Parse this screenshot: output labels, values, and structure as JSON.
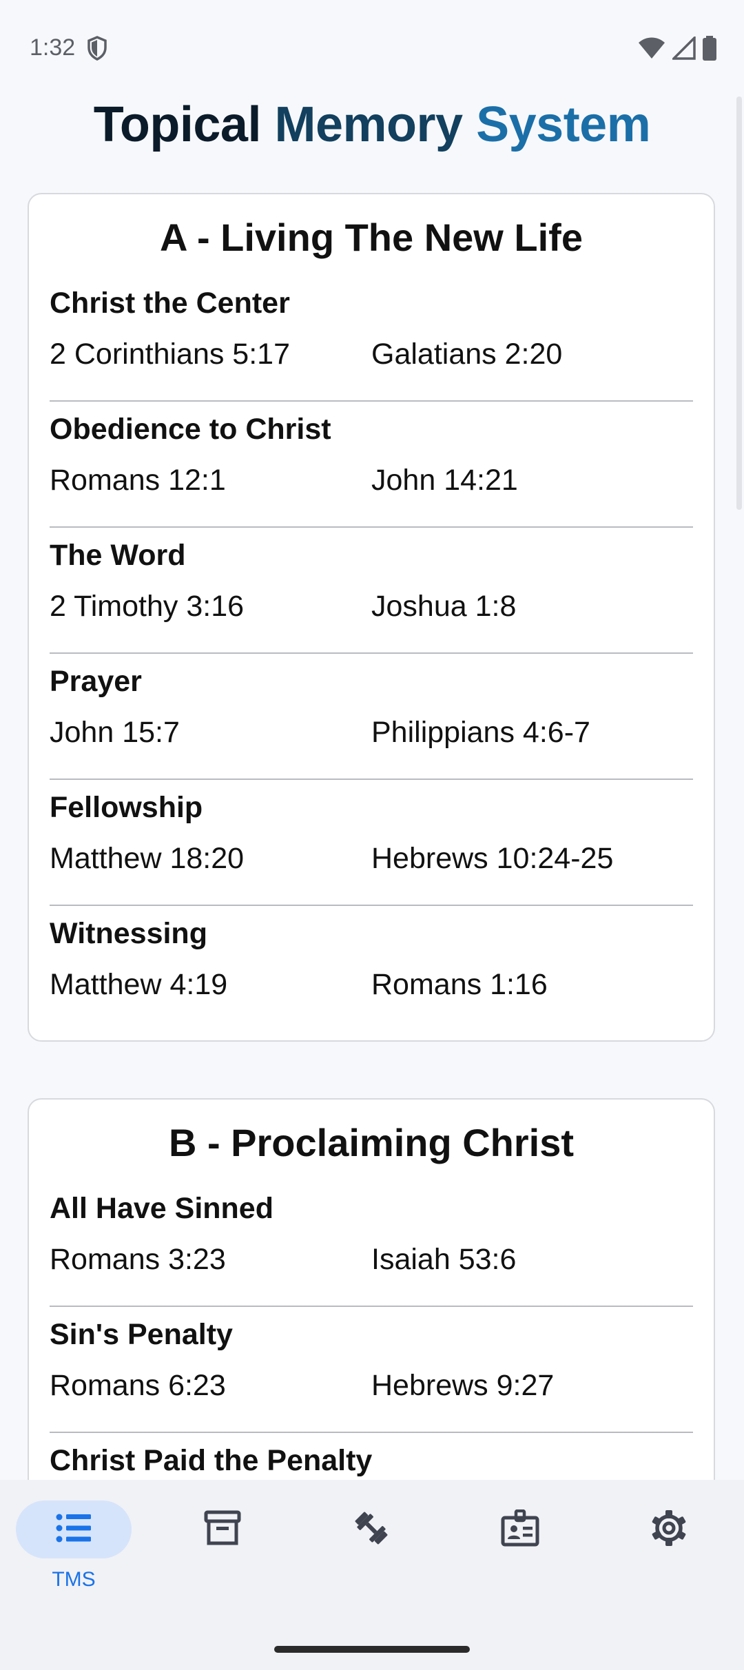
{
  "status": {
    "time": "1:32"
  },
  "app": {
    "title_1": "Topical",
    "title_2": "Memory",
    "title_3": "System"
  },
  "sections": [
    {
      "title": "A - Living The New Life",
      "topics": [
        {
          "name": "Christ the Center",
          "verses": [
            "2 Corinthians 5:17",
            "Galatians 2:20"
          ]
        },
        {
          "name": "Obedience to Christ",
          "verses": [
            "Romans 12:1",
            "John 14:21"
          ]
        },
        {
          "name": "The Word",
          "verses": [
            "2 Timothy 3:16",
            "Joshua 1:8"
          ]
        },
        {
          "name": "Prayer",
          "verses": [
            "John 15:7",
            "Philippians 4:6-7"
          ]
        },
        {
          "name": "Fellowship",
          "verses": [
            "Matthew 18:20",
            "Hebrews 10:24-25"
          ]
        },
        {
          "name": "Witnessing",
          "verses": [
            "Matthew 4:19",
            "Romans 1:16"
          ]
        }
      ]
    },
    {
      "title": "B - Proclaiming Christ",
      "topics": [
        {
          "name": "All Have Sinned",
          "verses": [
            "Romans 3:23",
            "Isaiah 53:6"
          ]
        },
        {
          "name": "Sin's Penalty",
          "verses": [
            "Romans 6:23",
            "Hebrews 9:27"
          ]
        },
        {
          "name": "Christ Paid the Penalty",
          "verses": [
            "",
            ""
          ]
        }
      ]
    }
  ],
  "nav": {
    "items": [
      {
        "icon": "list-icon",
        "label": "TMS",
        "active": true
      },
      {
        "icon": "archive-icon",
        "label": "",
        "active": false
      },
      {
        "icon": "dumbbell-icon",
        "label": "",
        "active": false
      },
      {
        "icon": "id-badge-icon",
        "label": "",
        "active": false
      },
      {
        "icon": "gear-icon",
        "label": "",
        "active": false
      }
    ]
  },
  "colors": {
    "accent": "#1a73e8",
    "active_pill": "#d6e4fb",
    "icon": "#3f4450"
  }
}
